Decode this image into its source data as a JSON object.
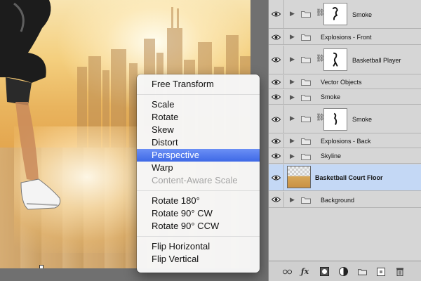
{
  "context_menu": {
    "items": [
      {
        "label": "Free Transform",
        "state": "normal"
      },
      {
        "separator": true
      },
      {
        "label": "Scale",
        "state": "normal"
      },
      {
        "label": "Rotate",
        "state": "normal"
      },
      {
        "label": "Skew",
        "state": "normal"
      },
      {
        "label": "Distort",
        "state": "normal"
      },
      {
        "label": "Perspective",
        "state": "selected"
      },
      {
        "label": "Warp",
        "state": "normal"
      },
      {
        "label": "Content-Aware Scale",
        "state": "disabled"
      },
      {
        "separator": true
      },
      {
        "label": "Rotate 180°",
        "state": "normal"
      },
      {
        "label": "Rotate 90° CW",
        "state": "normal"
      },
      {
        "label": "Rotate 90° CCW",
        "state": "normal"
      },
      {
        "separator": true
      },
      {
        "label": "Flip Horizontal",
        "state": "normal"
      },
      {
        "label": "Flip Vertical",
        "state": "normal"
      }
    ]
  },
  "layers": [
    {
      "name": "Smoke",
      "type": "group-masked",
      "bold": false,
      "active": false
    },
    {
      "name": "Explosions - Front",
      "type": "group",
      "bold": false,
      "active": false
    },
    {
      "name": "Basketball Player",
      "type": "group-masked",
      "bold": false,
      "active": false
    },
    {
      "name": "Vector Objects",
      "type": "group",
      "bold": false,
      "active": false
    },
    {
      "name": "Smoke",
      "type": "group",
      "bold": false,
      "active": false
    },
    {
      "name": "Smoke",
      "type": "group-masked",
      "bold": false,
      "active": false
    },
    {
      "name": "Explosions - Back",
      "type": "group",
      "bold": false,
      "active": false
    },
    {
      "name": "Skyline",
      "type": "group",
      "bold": false,
      "active": false
    },
    {
      "name": "Basketball Court Floor",
      "type": "image",
      "bold": true,
      "active": true
    },
    {
      "name": "Background",
      "type": "group",
      "bold": false,
      "active": false
    }
  ],
  "footer_icons": [
    "link-layers-icon",
    "fx-icon",
    "add-mask-icon",
    "adjustment-layer-icon",
    "new-group-icon",
    "new-layer-icon",
    "delete-layer-icon"
  ],
  "colors": {
    "menu_highlight": "#3e69e6",
    "active_layer": "#c4d8f5",
    "panel_bg": "#d6d6d6"
  }
}
